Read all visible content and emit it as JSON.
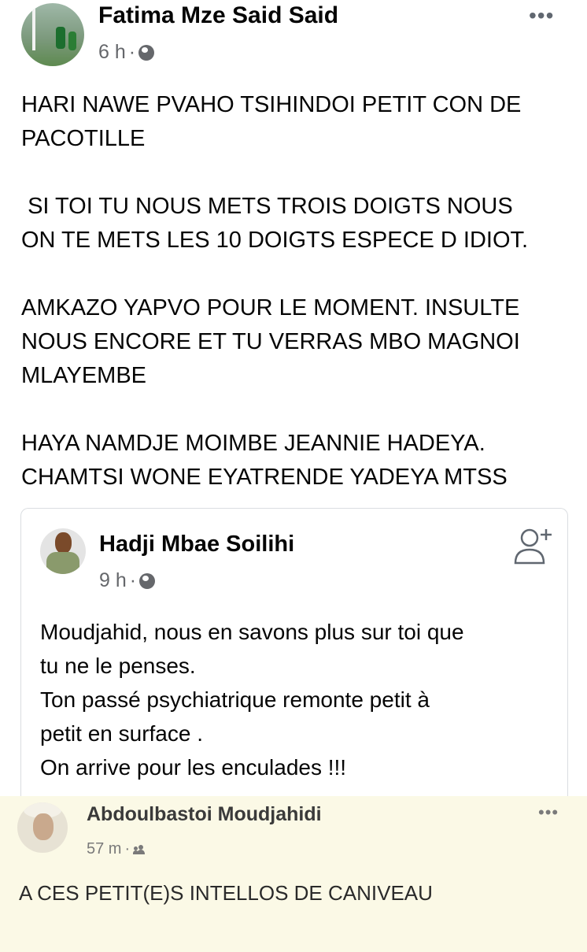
{
  "post": {
    "author": "Fatima Mze Said Said",
    "time": "6 h",
    "separator": "·",
    "privacy_icon": "globe-icon",
    "more_icon": "more-options-icon",
    "more_label": "•••",
    "body": "HARI NAWE PVAHO TSIHINDOI PETIT CON DE\nPACOTILLE\n\n SI TOI TU NOUS METS TROIS DOIGTS NOUS\nON TE METS LES 10 DOIGTS ESPECE D IDIOT.\n\nAMKAZO YAPVO POUR LE MOMENT. INSULTE\nNOUS ENCORE ET TU VERRAS MBO MAGNOI\nMLAYEMBE\n\nHAYA NAMDJE MOIMBE JEANNIE HADEYA.\nCHAMTSI WONE EYATRENDE YADEYA MTSS"
  },
  "shared_post": {
    "author": "Hadji Mbae Soilihi",
    "time": "9 h",
    "separator": "·",
    "privacy_icon": "globe-icon",
    "add_friend_icon": "add-friend-icon",
    "body": "Moudjahid, nous en savons plus sur toi que\ntu ne le penses.\nTon passé psychiatrique remonte petit à\npetit en surface .\nOn arrive pour les enculades !!!"
  },
  "third_post": {
    "author": "Abdoulbastoi Moudjahidi",
    "time": "57 m",
    "separator": "·",
    "privacy_icon": "friends-icon",
    "more_label": "•••",
    "body": "A CES PETIT(E)S INTELLOS DE CANIVEAU"
  },
  "colors": {
    "text": "#050505",
    "meta": "#65676b",
    "third_background": "#fbf9e6",
    "border": "#dadde1"
  }
}
